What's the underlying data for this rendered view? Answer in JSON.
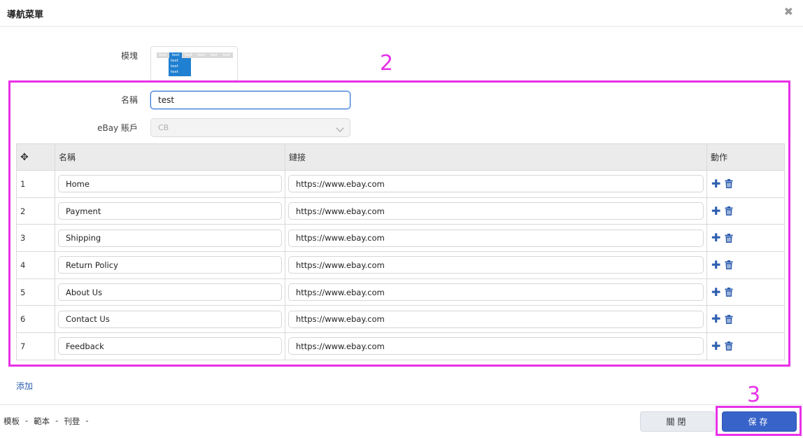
{
  "header": {
    "title": "導航菜單",
    "close_glyph": "✖"
  },
  "form": {
    "module_label": "模塊",
    "module_preview": {
      "tabs": [
        "text",
        "text",
        "text",
        "text",
        "text",
        "text"
      ],
      "dropdown": [
        "text",
        "text",
        "text"
      ]
    },
    "name_label": "名稱",
    "name_value": "test",
    "account_label": "eBay 賬戶",
    "account_value": "CB"
  },
  "table": {
    "headers": {
      "move_glyph": "✥",
      "name": "名稱",
      "link": "鏈接",
      "action": "動作"
    },
    "rows": [
      {
        "index": "1",
        "name": "Home",
        "url": "https://www.ebay.com"
      },
      {
        "index": "2",
        "name": "Payment",
        "url": "https://www.ebay.com"
      },
      {
        "index": "3",
        "name": "Shipping",
        "url": "https://www.ebay.com"
      },
      {
        "index": "4",
        "name": "Return Policy",
        "url": "https://www.ebay.com"
      },
      {
        "index": "5",
        "name": "About Us",
        "url": "https://www.ebay.com"
      },
      {
        "index": "6",
        "name": "Contact Us",
        "url": "https://www.ebay.com"
      },
      {
        "index": "7",
        "name": "Feedback",
        "url": "https://www.ebay.com"
      }
    ],
    "plus_glyph": "✚"
  },
  "add_link": "添加",
  "footer": {
    "crumbs": [
      "模板",
      "-",
      "範本",
      "-",
      "刊登",
      "-"
    ],
    "close_button": "關閉",
    "save_button": "保存"
  },
  "annotations": {
    "box_2_label": "2",
    "box_3_label": "3"
  },
  "colors": {
    "accent": "#3864c9",
    "annotation": "#e830e8",
    "icon_blue": "#2f5fb0"
  }
}
